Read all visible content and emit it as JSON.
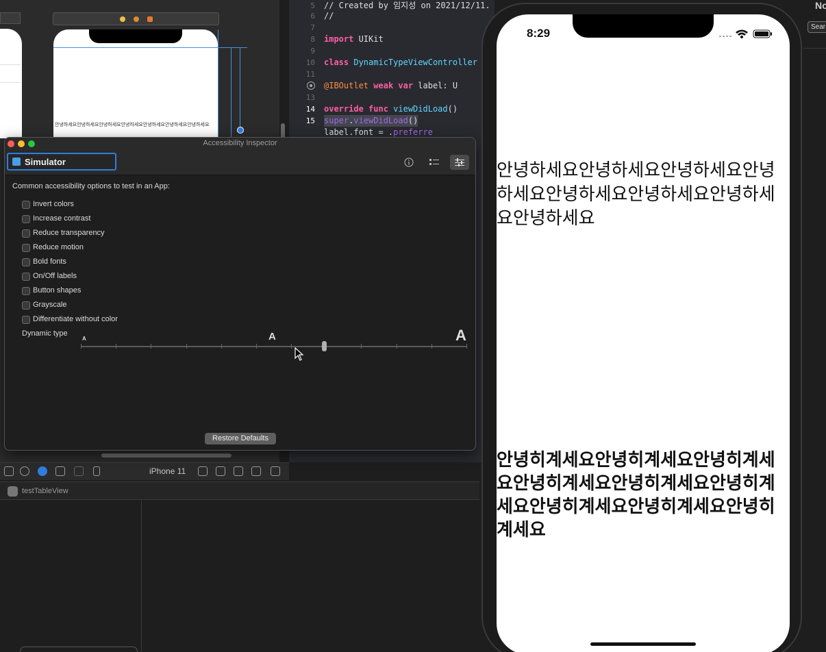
{
  "interface_builder": {
    "preview_label_text": "안녕하세요안녕하세요안녕하세요안녕하세요안녕하세요안녕하세요안녕하세요"
  },
  "code_editor": {
    "lines": [
      {
        "num": "5",
        "text": "//  Created by 임지성 on 2021/12/11."
      },
      {
        "num": "6",
        "text": "//"
      },
      {
        "num": "7",
        "text": ""
      },
      {
        "num": "8",
        "text": "import UIKit"
      },
      {
        "num": "9",
        "text": ""
      },
      {
        "num": "10",
        "text": "class DynamicTypeViewController"
      },
      {
        "num": "11",
        "text": ""
      },
      {
        "num": "",
        "text": "    @IBOutlet weak var label: U"
      },
      {
        "num": "13",
        "text": ""
      },
      {
        "num": "14",
        "text": "    override func viewDidLoad()"
      },
      {
        "num": "15",
        "text": "        super.viewDidLoad()"
      },
      {
        "num": "",
        "text": "        label.font = .preferre"
      }
    ]
  },
  "right_panel": {
    "top_label": "No",
    "search_label": "Sear"
  },
  "toolbar": {
    "device_name": "iPhone 11"
  },
  "outline": {
    "scene_name": "testTableView"
  },
  "inspector": {
    "window_title": "Accessibility Inspector",
    "target": "Simulator",
    "intro": "Common accessibility options to test in an App:",
    "options": [
      {
        "label": "Invert colors"
      },
      {
        "label": "Increase contrast"
      },
      {
        "label": "Reduce transparency"
      },
      {
        "label": "Reduce motion"
      },
      {
        "label": "Bold fonts"
      },
      {
        "label": "On/Off labels"
      },
      {
        "label": "Button shapes"
      },
      {
        "label": "Grayscale"
      },
      {
        "label": "Differentiate without color"
      }
    ],
    "dynamic_type_label": "Dynamic type",
    "slider_small": "A",
    "slider_mid": "A",
    "slider_big": "A",
    "restore_button": "Restore Defaults",
    "slider_value": 0.63
  },
  "simulator": {
    "time": "8:29",
    "label_top": "안녕하세요안녕하세요안녕하세요안녕하세요안녕하세요안녕하세요안녕하세요안녕하세요",
    "label_bottom": "안녕히계세요안녕히계세요안녕히계세요안녕히계세요안녕히계세요안녕히계세요안녕히계세요안녕히계세요안녕히계세요"
  }
}
